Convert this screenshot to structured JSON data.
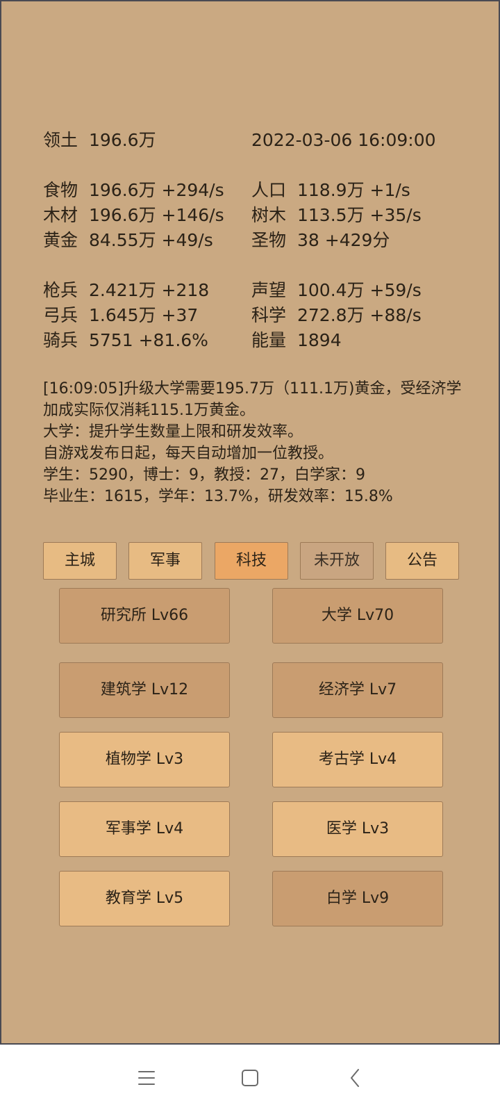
{
  "territory": {
    "label": "领土",
    "value": "196.6万"
  },
  "datetime": "2022-03-06 16:09:00",
  "resources_left": [
    {
      "label": "食物",
      "value": "196.6万 +294/s"
    },
    {
      "label": "木材",
      "value": "196.6万 +146/s"
    },
    {
      "label": "黄金",
      "value": "84.55万 +49/s"
    }
  ],
  "resources_right": [
    {
      "label": "人口",
      "value": "118.9万 +1/s"
    },
    {
      "label": "树木",
      "value": "113.5万 +35/s"
    },
    {
      "label": "圣物",
      "value": "38 +429分"
    }
  ],
  "military_left": [
    {
      "label": "枪兵",
      "value": "2.421万 +218"
    },
    {
      "label": "弓兵",
      "value": "1.645万 +37"
    },
    {
      "label": "骑兵",
      "value": "5751 +81.6%"
    }
  ],
  "military_right": [
    {
      "label": "声望",
      "value": "100.4万 +59/s"
    },
    {
      "label": "科学",
      "value": "272.8万 +88/s"
    },
    {
      "label": "能量",
      "value": "1894"
    }
  ],
  "message": [
    "[16:09:05]升级大学需要195.7万（111.1万)黄金，受经济学",
    "加成实际仅消耗115.1万黄金。",
    "大学：提升学生数量上限和研发效率。",
    "自游戏发布日起，每天自动增加一位教授。",
    "学生：5290，博士：9，教授：27，白学家：9",
    "毕业生：1615，学年：13.7%，研发效率：15.8%"
  ],
  "tabs": [
    {
      "label": "主城",
      "state": "normal"
    },
    {
      "label": "军事",
      "state": "normal"
    },
    {
      "label": "科技",
      "state": "active"
    },
    {
      "label": "未开放",
      "state": "disabled"
    },
    {
      "label": "公告",
      "state": "normal"
    }
  ],
  "techs": [
    {
      "label": "研究所 Lv66",
      "style": "dark"
    },
    {
      "label": "大学 Lv70",
      "style": "dark"
    },
    {
      "label": "建筑学 Lv12",
      "style": "dark"
    },
    {
      "label": "经济学 Lv7",
      "style": "dark"
    },
    {
      "label": "植物学 Lv3",
      "style": "light"
    },
    {
      "label": "考古学 Lv4",
      "style": "light"
    },
    {
      "label": "军事学 Lv4",
      "style": "light"
    },
    {
      "label": "医学 Lv3",
      "style": "light"
    },
    {
      "label": "教育学 Lv5",
      "style": "light"
    },
    {
      "label": "白学 Lv9",
      "style": "dark"
    }
  ],
  "colors": {
    "panel_bg": "#caa982",
    "button_light": "#e8bb84",
    "button_dark": "#c99d71",
    "tab_active": "#eba765"
  },
  "nav_icons": [
    "menu-icon",
    "home-icon",
    "back-icon"
  ]
}
